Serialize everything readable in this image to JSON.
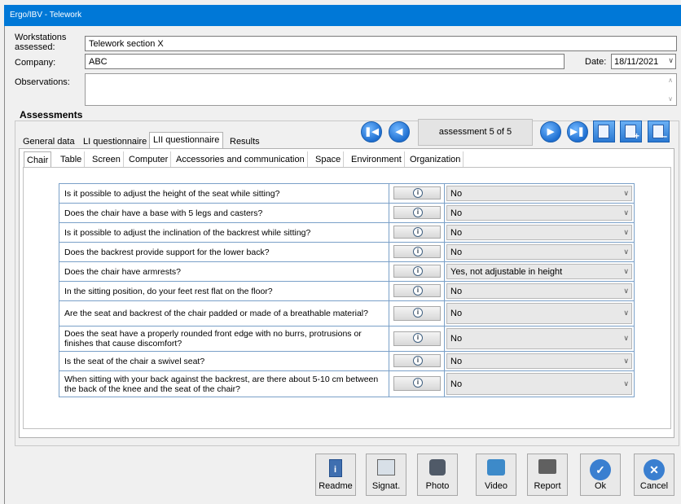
{
  "window": {
    "title": "Ergo/IBV - Telework"
  },
  "form": {
    "workstations_label": "Workstations assessed:",
    "workstations_value": "Telework section X",
    "company_label": "Company:",
    "company_value": "ABC",
    "date_label": "Date:",
    "date_value": "18/11/2021",
    "observations_label": "Observations:",
    "observations_value": ""
  },
  "assessments": {
    "title": "Assessments",
    "counter": "assessment 5 of 5",
    "tabs": [
      "General data",
      "LI questionnaire",
      "LII questionnaire",
      "Results"
    ],
    "active_tab": "LII questionnaire",
    "subtabs": [
      "Chair",
      "Table",
      "Screen",
      "Computer",
      "Accessories and communication",
      "Space",
      "Environment",
      "Organization"
    ],
    "active_subtab": "Chair"
  },
  "questions": [
    {
      "text": "Is it possible to adjust the height of the seat while sitting?",
      "answer": "No"
    },
    {
      "text": "Does the chair have a base with 5 legs and casters?",
      "answer": "No"
    },
    {
      "text": "Is it possible to adjust the inclination of the backrest while sitting?",
      "answer": "No"
    },
    {
      "text": "Does the backrest provide support for the lower back?",
      "answer": "No"
    },
    {
      "text": "Does the chair have armrests?",
      "answer": "Yes, not adjustable in height"
    },
    {
      "text": "In the sitting position, do your feet rest flat on the floor?",
      "answer": "No"
    },
    {
      "text": "Are the seat and backrest of the chair padded or made of a breathable material?",
      "answer": "No"
    },
    {
      "text": "Does the seat have a properly rounded front edge with no burrs, protrusions or finishes that cause discomfort?",
      "answer": "No"
    },
    {
      "text": "Is the seat of the chair a swivel seat?",
      "answer": "No"
    },
    {
      "text": "When sitting with your back against the backrest, are there about 5-10 cm between the back of the knee and the seat of the chair?",
      "answer": "No"
    }
  ],
  "buttons": {
    "readme": "Readme",
    "signat": "Signat.",
    "photo": "Photo",
    "video": "Video",
    "report": "Report",
    "ok": "Ok",
    "cancel": "Cancel"
  },
  "colors": {
    "titlebar": "#0078d7",
    "accent": "#1f6fd0"
  }
}
